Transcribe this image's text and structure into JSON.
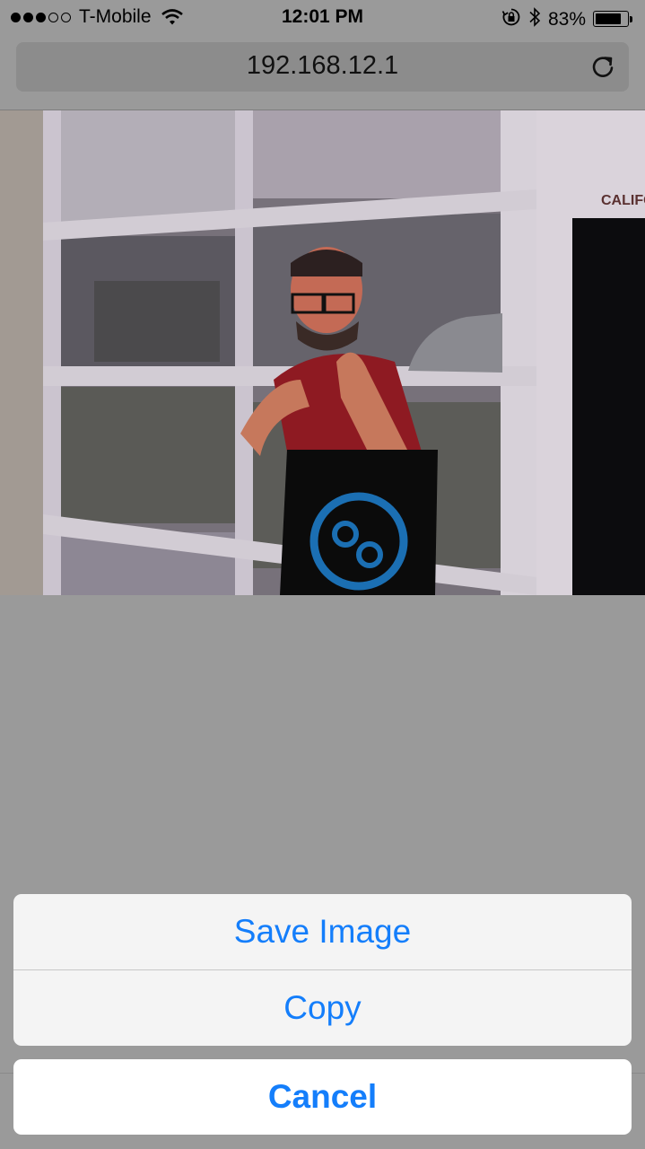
{
  "status_bar": {
    "carrier": "T-Mobile",
    "signal_bars_filled": 3,
    "signal_bars_total": 5,
    "time": "12:01 PM",
    "battery_percent_label": "83%",
    "battery_level": 0.83,
    "icons": [
      "wifi-icon",
      "orientation-lock-icon",
      "bluetooth-icon",
      "battery-icon"
    ]
  },
  "browser": {
    "url": "192.168.12.1",
    "reload_icon": "reload-icon"
  },
  "photo": {
    "sign_text": "CALIFO"
  },
  "action_sheet": {
    "save_image_label": "Save Image",
    "copy_label": "Copy",
    "cancel_label": "Cancel",
    "accent_color": "#147efb"
  }
}
